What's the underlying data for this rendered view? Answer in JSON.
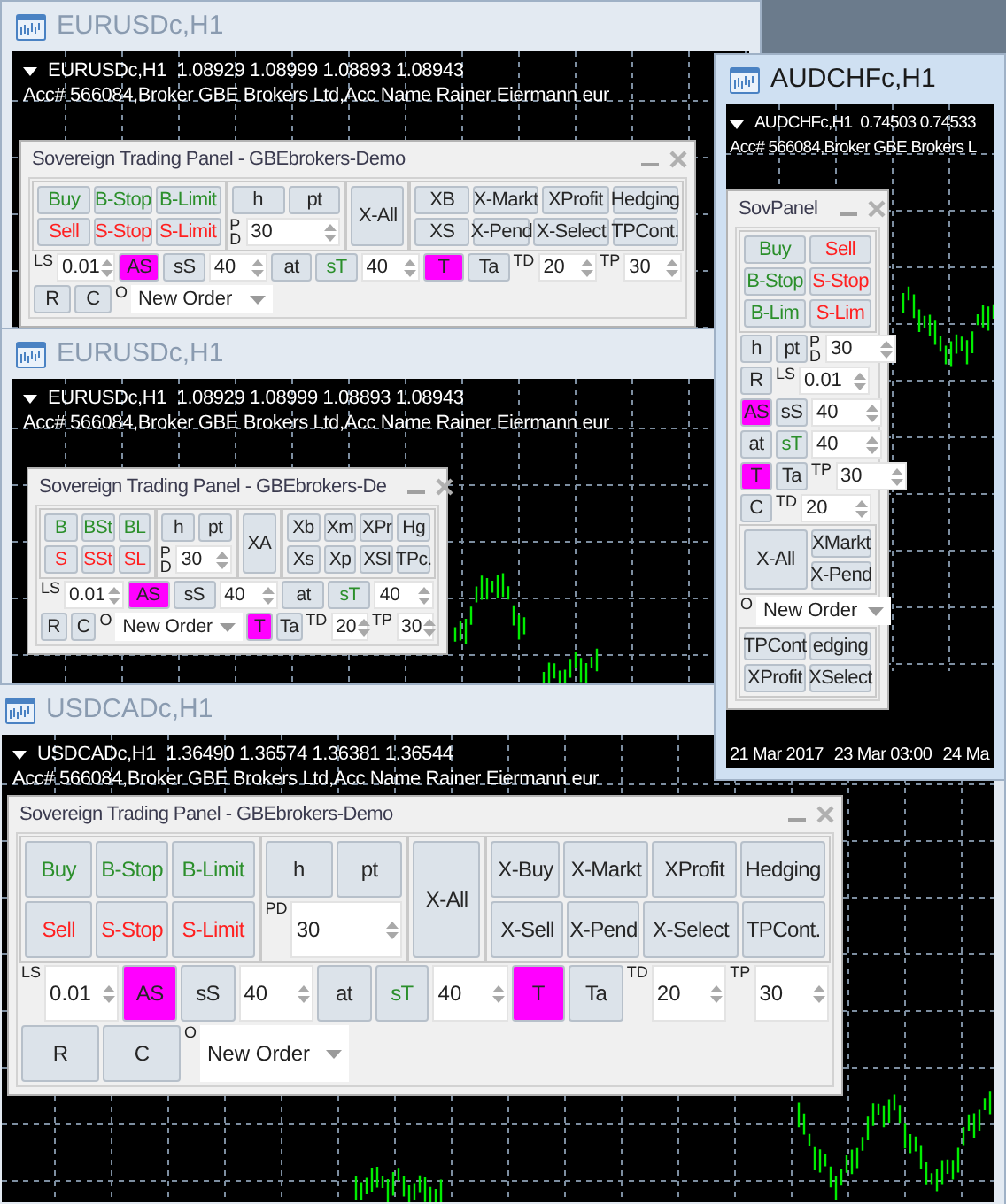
{
  "windows": [
    {
      "title": "EURUSDc,H1",
      "active": false,
      "symbol_line": "EURUSDc,H1  1.08929 1.08999 1.08893 1.08943",
      "account_line": "Acc# 566084,Broker GBE Brokers Ltd,Acc Name Rainer Eiermann eur",
      "panel": {
        "kind": "medium",
        "title": "Sovereign Trading Panel - GBEbrokers-Demo",
        "body": [
          {
            "kind": "row",
            "children": [
              {
                "kind": "box",
                "children": [
                  {
                    "kind": "row",
                    "children": [
                      {
                        "kind": "button",
                        "label": "Buy",
                        "color": "#2b8f2b"
                      },
                      {
                        "kind": "button",
                        "label": "B-Stop",
                        "color": "#2b8f2b"
                      },
                      {
                        "kind": "button",
                        "label": "B-Limit",
                        "color": "#2b8f2b"
                      }
                    ]
                  },
                  {
                    "kind": "row",
                    "children": [
                      {
                        "kind": "button",
                        "label": "Sell",
                        "color": "#ff2020"
                      },
                      {
                        "kind": "button",
                        "label": "S-Stop",
                        "color": "#ff2020"
                      },
                      {
                        "kind": "button",
                        "label": "S-Limit",
                        "color": "#ff2020"
                      }
                    ]
                  }
                ]
              },
              {
                "kind": "box",
                "children": [
                  {
                    "kind": "row",
                    "children": [
                      {
                        "kind": "button",
                        "label": "h"
                      },
                      {
                        "kind": "button",
                        "label": "pt"
                      }
                    ]
                  },
                  {
                    "kind": "row",
                    "children": [
                      {
                        "kind": "vtag",
                        "label": "PD"
                      },
                      {
                        "kind": "spin",
                        "value": "30"
                      }
                    ]
                  }
                ]
              },
              {
                "kind": "box",
                "children": [
                  {
                    "kind": "button",
                    "label": "X-All"
                  }
                ]
              },
              {
                "kind": "box",
                "children": [
                  {
                    "kind": "row",
                    "children": [
                      {
                        "kind": "button",
                        "label": "XB"
                      },
                      {
                        "kind": "button",
                        "label": "X-Markt"
                      },
                      {
                        "kind": "button",
                        "label": "XProfit"
                      },
                      {
                        "kind": "button",
                        "label": "Hedging"
                      }
                    ]
                  },
                  {
                    "kind": "row",
                    "children": [
                      {
                        "kind": "button",
                        "label": "XS"
                      },
                      {
                        "kind": "button",
                        "label": "X-Pend"
                      },
                      {
                        "kind": "button",
                        "label": "X-Select"
                      },
                      {
                        "kind": "button",
                        "label": "TPCont."
                      }
                    ]
                  }
                ]
              }
            ]
          },
          {
            "kind": "row",
            "children": [
              {
                "kind": "tag",
                "label": "LS"
              },
              {
                "kind": "spin",
                "value": "0.01"
              },
              {
                "kind": "toggle",
                "label": "AS",
                "on": true
              },
              {
                "kind": "toggle",
                "label": "sS",
                "on": false
              },
              {
                "kind": "spin",
                "value": "40"
              },
              {
                "kind": "button",
                "label": "at"
              },
              {
                "kind": "button",
                "label": "sT",
                "color": "#2b8f2b"
              },
              {
                "kind": "spin",
                "value": "40"
              },
              {
                "kind": "toggle",
                "label": "T",
                "on": true
              },
              {
                "kind": "toggle",
                "label": "Ta",
                "on": false
              },
              {
                "kind": "tag",
                "label": "TD"
              },
              {
                "kind": "spin",
                "value": "20"
              },
              {
                "kind": "tag",
                "label": "TP"
              },
              {
                "kind": "spin",
                "value": "30"
              }
            ]
          },
          {
            "kind": "lrow",
            "children": [
              {
                "kind": "button",
                "label": "R"
              },
              {
                "kind": "button",
                "label": "C"
              },
              {
                "kind": "tag",
                "label": "O"
              },
              {
                "kind": "dropdown",
                "value": "New Order"
              }
            ]
          }
        ]
      }
    },
    {
      "title": "AUDCHFc,H1",
      "active": true,
      "symbol_line": "AUDCHFc,H1  0.74503 0.74533",
      "account_line": "Acc# 566084,Broker GBE Brokers L",
      "axis_labels": [
        "21 Mar 2017",
        "23 Mar 03:00",
        "24 Ma"
      ],
      "panel": {
        "kind": "narrow",
        "title": "SovPanel",
        "body": [
          {
            "kind": "box",
            "children": [
              {
                "kind": "row",
                "children": [
                  {
                    "kind": "button",
                    "label": "Buy",
                    "color": "#2b8f2b"
                  },
                  {
                    "kind": "button",
                    "label": "Sell",
                    "color": "#ff2020"
                  }
                ]
              },
              {
                "kind": "row",
                "children": [
                  {
                    "kind": "button",
                    "label": "B-Stop",
                    "color": "#2b8f2b"
                  },
                  {
                    "kind": "button",
                    "label": "S-Stop",
                    "color": "#ff2020"
                  }
                ]
              },
              {
                "kind": "row",
                "children": [
                  {
                    "kind": "button",
                    "label": "B-Lim",
                    "color": "#2b8f2b"
                  },
                  {
                    "kind": "button",
                    "label": "S-Lim",
                    "color": "#ff2020"
                  }
                ]
              }
            ]
          },
          {
            "kind": "lrow",
            "children": [
              {
                "kind": "button",
                "label": "h"
              },
              {
                "kind": "button",
                "label": "pt"
              },
              {
                "kind": "vtag",
                "label": "PD"
              },
              {
                "kind": "spin",
                "value": "30"
              }
            ]
          },
          {
            "kind": "lrow",
            "children": [
              {
                "kind": "button",
                "label": "R"
              },
              {
                "kind": "tag",
                "label": "LS"
              },
              {
                "kind": "spin",
                "value": "0.01"
              }
            ]
          },
          {
            "kind": "lrow",
            "children": [
              {
                "kind": "toggle",
                "label": "AS",
                "on": true
              },
              {
                "kind": "toggle",
                "label": "sS",
                "on": false
              },
              {
                "kind": "spin",
                "value": "40"
              }
            ]
          },
          {
            "kind": "lrow",
            "children": [
              {
                "kind": "button",
                "label": "at"
              },
              {
                "kind": "button",
                "label": "sT",
                "color": "#2b8f2b"
              },
              {
                "kind": "spin",
                "value": "40"
              }
            ]
          },
          {
            "kind": "lrow",
            "children": [
              {
                "kind": "toggle",
                "label": "T",
                "on": true
              },
              {
                "kind": "toggle",
                "label": "Ta",
                "on": false
              },
              {
                "kind": "tag",
                "label": "TP"
              },
              {
                "kind": "spin",
                "value": "30"
              }
            ]
          },
          {
            "kind": "lrow",
            "children": [
              {
                "kind": "button",
                "label": "C"
              },
              {
                "kind": "tag",
                "label": "TD"
              },
              {
                "kind": "spin",
                "value": "20"
              }
            ]
          },
          {
            "kind": "box",
            "children": [
              {
                "kind": "row",
                "children": [
                  {
                    "kind": "button",
                    "label": "X-All"
                  },
                  {
                    "kind": "col",
                    "children": [
                      {
                        "kind": "button",
                        "label": "XMarkt"
                      },
                      {
                        "kind": "button",
                        "label": "X-Pend"
                      }
                    ]
                  }
                ]
              }
            ]
          },
          {
            "kind": "lrow",
            "children": [
              {
                "kind": "tag",
                "label": "O"
              },
              {
                "kind": "dropdown",
                "value": "New Order"
              }
            ]
          },
          {
            "kind": "box",
            "children": [
              {
                "kind": "row",
                "children": [
                  {
                    "kind": "button",
                    "label": "TPCont"
                  },
                  {
                    "kind": "button",
                    "label": "edging"
                  }
                ]
              },
              {
                "kind": "row",
                "children": [
                  {
                    "kind": "button",
                    "label": "XProfit"
                  },
                  {
                    "kind": "button",
                    "label": "XSelect"
                  }
                ]
              }
            ]
          }
        ]
      }
    },
    {
      "title": "EURUSDc,H1",
      "active": false,
      "symbol_line": "EURUSDc,H1  1.08929 1.08999 1.08893 1.08943",
      "account_line": "Acc# 566084,Broker GBE Brokers Ltd,Acc Name Rainer Eiermann eur",
      "panel": {
        "kind": "small",
        "title": "Sovereign Trading Panel - GBEbrokers-De",
        "body": [
          {
            "kind": "row",
            "children": [
              {
                "kind": "box",
                "children": [
                  {
                    "kind": "row",
                    "children": [
                      {
                        "kind": "button",
                        "label": "B",
                        "color": "#2b8f2b"
                      },
                      {
                        "kind": "button",
                        "label": "BSt",
                        "color": "#2b8f2b"
                      },
                      {
                        "kind": "button",
                        "label": "BL",
                        "color": "#2b8f2b"
                      }
                    ]
                  },
                  {
                    "kind": "row",
                    "children": [
                      {
                        "kind": "button",
                        "label": "S",
                        "color": "#ff2020"
                      },
                      {
                        "kind": "button",
                        "label": "SSt",
                        "color": "#ff2020"
                      },
                      {
                        "kind": "button",
                        "label": "SL",
                        "color": "#ff2020"
                      }
                    ]
                  }
                ]
              },
              {
                "kind": "box",
                "children": [
                  {
                    "kind": "row",
                    "children": [
                      {
                        "kind": "button",
                        "label": "h"
                      },
                      {
                        "kind": "button",
                        "label": "pt"
                      }
                    ]
                  },
                  {
                    "kind": "row",
                    "children": [
                      {
                        "kind": "vtag",
                        "label": "PD"
                      },
                      {
                        "kind": "spin",
                        "value": "30"
                      }
                    ]
                  }
                ]
              },
              {
                "kind": "box",
                "children": [
                  {
                    "kind": "button",
                    "label": "XA"
                  }
                ]
              },
              {
                "kind": "box",
                "children": [
                  {
                    "kind": "row",
                    "children": [
                      {
                        "kind": "button",
                        "label": "Xb"
                      },
                      {
                        "kind": "button",
                        "label": "Xm"
                      },
                      {
                        "kind": "button",
                        "label": "XPr"
                      },
                      {
                        "kind": "button",
                        "label": "Hg"
                      }
                    ]
                  },
                  {
                    "kind": "row",
                    "children": [
                      {
                        "kind": "button",
                        "label": "Xs"
                      },
                      {
                        "kind": "button",
                        "label": "Xp"
                      },
                      {
                        "kind": "button",
                        "label": "XSl"
                      },
                      {
                        "kind": "button",
                        "label": "TPc."
                      }
                    ]
                  }
                ]
              }
            ]
          },
          {
            "kind": "row",
            "children": [
              {
                "kind": "tag",
                "label": "LS"
              },
              {
                "kind": "spin",
                "value": "0.01"
              },
              {
                "kind": "toggle",
                "label": "AS",
                "on": true
              },
              {
                "kind": "toggle",
                "label": "sS",
                "on": false
              },
              {
                "kind": "spin",
                "value": "40"
              },
              {
                "kind": "button",
                "label": "at"
              },
              {
                "kind": "button",
                "label": "sT",
                "color": "#2b8f2b"
              },
              {
                "kind": "spin",
                "value": "40"
              }
            ]
          },
          {
            "kind": "row",
            "children": [
              {
                "kind": "button",
                "label": "R"
              },
              {
                "kind": "button",
                "label": "C"
              },
              {
                "kind": "tag",
                "label": "O"
              },
              {
                "kind": "dropdown",
                "value": "New Order"
              },
              {
                "kind": "toggle",
                "label": "T",
                "on": true
              },
              {
                "kind": "toggle",
                "label": "Ta",
                "on": false
              },
              {
                "kind": "tag",
                "label": "TD"
              },
              {
                "kind": "spin",
                "value": "20"
              },
              {
                "kind": "tag",
                "label": "TP"
              },
              {
                "kind": "spin",
                "value": "30"
              }
            ]
          }
        ]
      }
    },
    {
      "title": "USDCADc,H1",
      "active": false,
      "symbol_line": "USDCADc,H1  1.36490 1.36574 1.36381 1.36544",
      "account_line": "Acc# 566084,Broker GBE Brokers Ltd,Acc Name Rainer Eiermann eur",
      "panel": {
        "kind": "large",
        "title": "Sovereign Trading Panel - GBEbrokers-Demo",
        "body": [
          {
            "kind": "row",
            "children": [
              {
                "kind": "box",
                "children": [
                  {
                    "kind": "row",
                    "children": [
                      {
                        "kind": "button",
                        "label": "Buy",
                        "color": "#2b8f2b"
                      },
                      {
                        "kind": "button",
                        "label": "B-Stop",
                        "color": "#2b8f2b"
                      },
                      {
                        "kind": "button",
                        "label": "B-Limit",
                        "color": "#2b8f2b"
                      }
                    ]
                  },
                  {
                    "kind": "row",
                    "children": [
                      {
                        "kind": "button",
                        "label": "Sell",
                        "color": "#ff2020"
                      },
                      {
                        "kind": "button",
                        "label": "S-Stop",
                        "color": "#ff2020"
                      },
                      {
                        "kind": "button",
                        "label": "S-Limit",
                        "color": "#ff2020"
                      }
                    ]
                  }
                ]
              },
              {
                "kind": "box",
                "children": [
                  {
                    "kind": "row",
                    "children": [
                      {
                        "kind": "button",
                        "label": "h"
                      },
                      {
                        "kind": "button",
                        "label": "pt"
                      }
                    ]
                  },
                  {
                    "kind": "row",
                    "children": [
                      {
                        "kind": "tag",
                        "label": "PD"
                      },
                      {
                        "kind": "spin",
                        "value": "30"
                      }
                    ]
                  }
                ]
              },
              {
                "kind": "box",
                "children": [
                  {
                    "kind": "button",
                    "label": "X-All"
                  }
                ]
              },
              {
                "kind": "box",
                "children": [
                  {
                    "kind": "row",
                    "children": [
                      {
                        "kind": "button",
                        "label": "X-Buy"
                      },
                      {
                        "kind": "button",
                        "label": "X-Markt"
                      },
                      {
                        "kind": "button",
                        "label": "XProfit"
                      },
                      {
                        "kind": "button",
                        "label": "Hedging"
                      }
                    ]
                  },
                  {
                    "kind": "row",
                    "children": [
                      {
                        "kind": "button",
                        "label": "X-Sell"
                      },
                      {
                        "kind": "button",
                        "label": "X-Pend"
                      },
                      {
                        "kind": "button",
                        "label": "X-Select"
                      },
                      {
                        "kind": "button",
                        "label": "TPCont."
                      }
                    ]
                  }
                ]
              }
            ]
          },
          {
            "kind": "row",
            "children": [
              {
                "kind": "tag",
                "label": "LS"
              },
              {
                "kind": "spin",
                "value": "0.01"
              },
              {
                "kind": "toggle",
                "label": "AS",
                "on": true
              },
              {
                "kind": "toggle",
                "label": "sS",
                "on": false
              },
              {
                "kind": "spin",
                "value": "40"
              },
              {
                "kind": "button",
                "label": "at"
              },
              {
                "kind": "button",
                "label": "sT",
                "color": "#2b8f2b"
              },
              {
                "kind": "spin",
                "value": "40"
              },
              {
                "kind": "toggle",
                "label": "T",
                "on": true
              },
              {
                "kind": "toggle",
                "label": "Ta",
                "on": false
              },
              {
                "kind": "tag",
                "label": "TD"
              },
              {
                "kind": "spin",
                "value": "20"
              },
              {
                "kind": "tag",
                "label": "TP"
              },
              {
                "kind": "spin",
                "value": "30"
              }
            ]
          },
          {
            "kind": "lrow",
            "children": [
              {
                "kind": "button",
                "label": "R"
              },
              {
                "kind": "button",
                "label": "C"
              },
              {
                "kind": "tag",
                "label": "O"
              },
              {
                "kind": "dropdown",
                "value": "New Order"
              }
            ]
          }
        ]
      }
    }
  ]
}
